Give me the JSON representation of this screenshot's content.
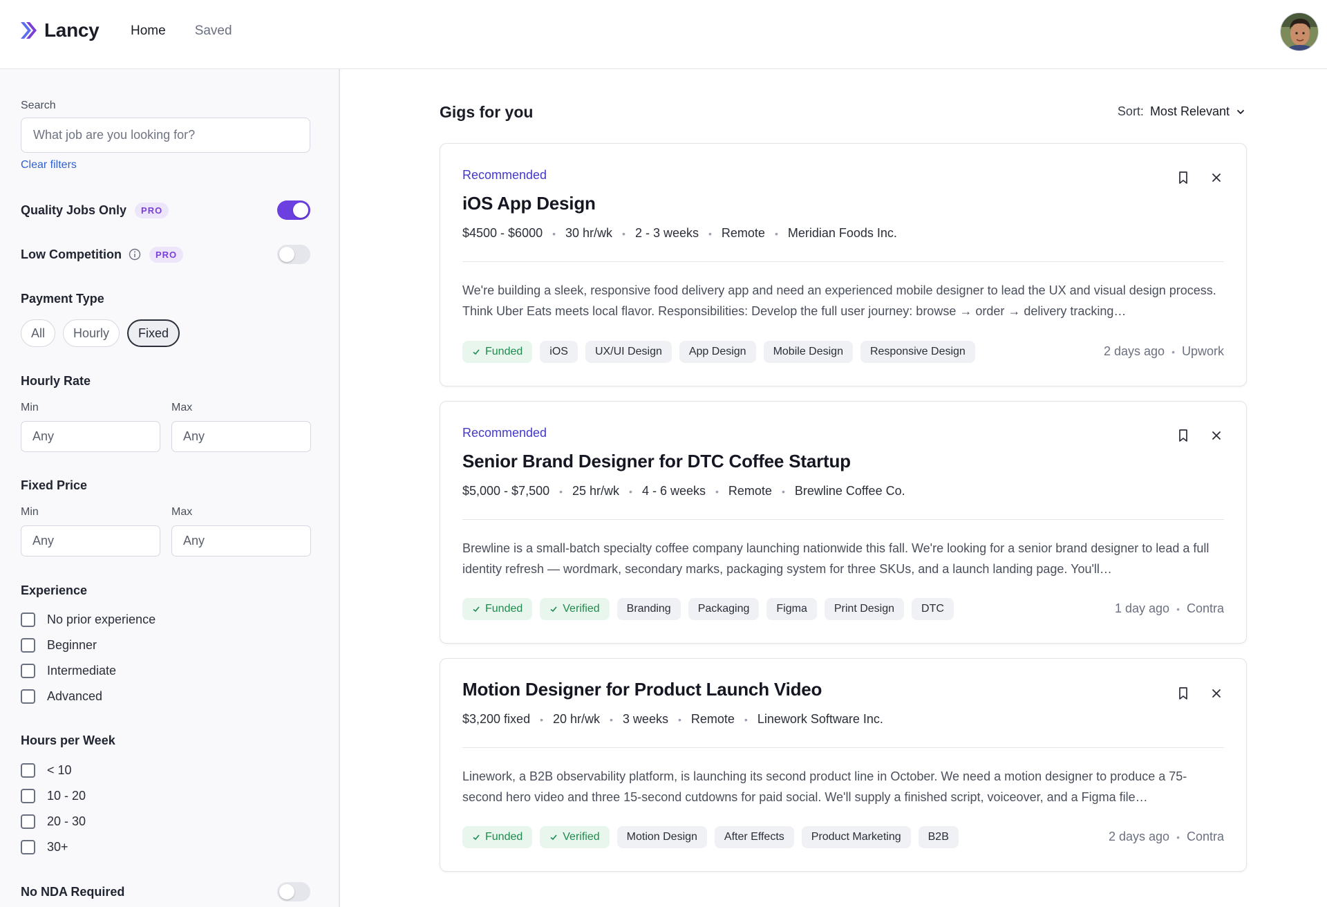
{
  "brand": {
    "name": "Lancy",
    "accent": "#6b3fe0"
  },
  "nav": [
    {
      "label": "Home"
    },
    {
      "label": "Saved"
    }
  ],
  "sidebar": {
    "search_label": "Search",
    "search_placeholder": "What job are you looking for?",
    "clear_filters": "Clear filters",
    "quality_jobs": {
      "label": "Quality Jobs Only",
      "badge": "PRO",
      "enabled": true
    },
    "low_competition": {
      "label": "Low Competition",
      "badge": "PRO",
      "enabled": false
    },
    "payment_type": {
      "title": "Payment Type",
      "options": [
        "All",
        "Hourly",
        "Fixed"
      ],
      "selected": "Fixed"
    },
    "hourly_rate": {
      "title": "Hourly Rate",
      "min_label": "Min",
      "max_label": "Max",
      "min_placeholder": "Any",
      "max_placeholder": "Any"
    },
    "fixed_price": {
      "title": "Fixed Price",
      "min_label": "Min",
      "max_label": "Max",
      "min_placeholder": "Any",
      "max_placeholder": "Any"
    },
    "experience": {
      "title": "Experience",
      "options": [
        "No prior experience",
        "Beginner",
        "Intermediate",
        "Advanced"
      ]
    },
    "hours_per_week": {
      "title": "Hours per Week",
      "options": [
        "< 10",
        "10 - 20",
        "20 - 30",
        "30+"
      ]
    },
    "no_nda": {
      "label": "No NDA Required",
      "enabled": false
    }
  },
  "main": {
    "title": "Gigs for you",
    "sort_label": "Sort:",
    "sort_value": "Most Relevant",
    "gigs": [
      {
        "recommended": "Recommended",
        "title": "iOS App Design",
        "budget": "$4500 - $6000",
        "hours": "30 hr/wk",
        "duration": "2 - 3 weeks",
        "location": "Remote",
        "company": "Meridian Foods Inc.",
        "description": "We're building a sleek, responsive food delivery app and need an experienced mobile designer to lead the UX and visual design process. Think Uber Eats meets local flavor. Responsibilities: Develop the full user journey: browse → order → delivery tracking…",
        "badges": [
          "Funded"
        ],
        "tags": [
          "iOS",
          "UX/UI Design",
          "App Design",
          "Mobile Design",
          "Responsive Design"
        ],
        "posted": "2 days ago",
        "source": "Upwork"
      },
      {
        "recommended": "Recommended",
        "title": "Senior Brand Designer for DTC Coffee Startup",
        "budget": "$5,000 - $7,500",
        "hours": "25 hr/wk",
        "duration": "4 - 6 weeks",
        "location": "Remote",
        "company": "Brewline Coffee Co.",
        "description": "Brewline is a small-batch specialty coffee company launching nationwide this fall. We're looking for a senior brand designer to lead a full identity refresh — wordmark, secondary marks, packaging system for three SKUs, and a launch landing page. You'll…",
        "badges": [
          "Funded",
          "Verified"
        ],
        "tags": [
          "Branding",
          "Packaging",
          "Figma",
          "Print Design",
          "DTC"
        ],
        "posted": "1 day ago",
        "source": "Contra"
      },
      {
        "recommended": "",
        "title": "Motion Designer for Product Launch Video",
        "budget": "$3,200 fixed",
        "hours": "20 hr/wk",
        "duration": "3 weeks",
        "location": "Remote",
        "company": "Linework Software Inc.",
        "description": "Linework, a B2B observability platform, is launching its second product line in October. We need a motion designer to produce a 75-second hero video and three 15-second cutdowns for paid social. We'll supply a finished script, voiceover, and a Figma file…",
        "badges": [
          "Funded",
          "Verified"
        ],
        "tags": [
          "Motion Design",
          "After Effects",
          "Product Marketing",
          "B2B"
        ],
        "posted": "2 days ago",
        "source": "Contra"
      }
    ]
  }
}
